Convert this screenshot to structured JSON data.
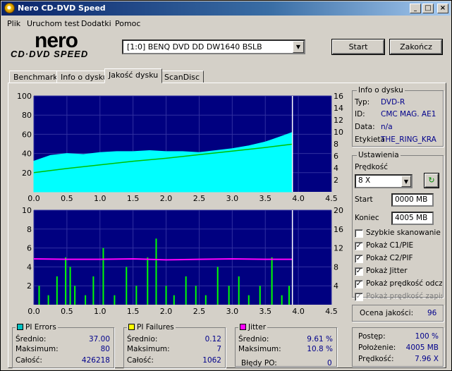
{
  "window": {
    "title": "Nero CD-DVD Speed"
  },
  "menu": [
    "Plik",
    "Uruchom test",
    "Dodatki",
    "Pomoc"
  ],
  "logo": {
    "nero": "nero",
    "sub": "CD·DVD SPEED"
  },
  "drive": {
    "selected": "[1:0]  BENQ DVD DD DW1640 BSLB"
  },
  "buttons": {
    "start": "Start",
    "stop": "Zakończ"
  },
  "tabs": [
    "Benchmark",
    "Info o dysku",
    "Jakość dysku",
    "ScanDisc"
  ],
  "disc_info": {
    "title": "Info o dysku",
    "type_label": "Typ:",
    "type": "DVD-R",
    "id_label": "ID:",
    "id": "CMC MAG. AE1",
    "date_label": "Data:",
    "date": "n/a",
    "label_label": "Etykieta",
    "label": "THE_RING_KRA"
  },
  "settings": {
    "title": "Ustawienia",
    "speed_label": "Prędkość",
    "speed": "8 X",
    "start_label": "Start",
    "start": "0000 MB",
    "end_label": "Koniec",
    "end": "4005 MB",
    "checks": [
      {
        "label": "Szybkie skanowanie",
        "checked": false,
        "enabled": true
      },
      {
        "label": "Pokaż C1/PIE",
        "checked": true,
        "enabled": true
      },
      {
        "label": "Pokaż C2/PIF",
        "checked": true,
        "enabled": true
      },
      {
        "label": "Pokaż Jitter",
        "checked": true,
        "enabled": true
      },
      {
        "label": "Pokaż prędkość odczytu",
        "checked": true,
        "enabled": true
      },
      {
        "label": "Pokaż prędkość zapisu",
        "checked": true,
        "enabled": false
      }
    ]
  },
  "quality": {
    "label": "Ocena jakości:",
    "value": "96"
  },
  "pi_errors": {
    "title": "PI Errors",
    "color": "#00c0c0",
    "avg_label": "Średnio:",
    "avg": "37.00",
    "max_label": "Maksimum:",
    "max": "80",
    "total_label": "Całość:",
    "total": "426218"
  },
  "pi_failures": {
    "title": "PI Failures",
    "color": "#ffff00",
    "avg_label": "Średnio:",
    "avg": "0.12",
    "max_label": "Maksimum:",
    "max": "7",
    "total_label": "Całość:",
    "total": "1062"
  },
  "jitter": {
    "title": "Jitter",
    "color": "#ff00ff",
    "avg_label": "Średnio:",
    "avg": "9.61 %",
    "max_label": "Maksimum:",
    "max": "10.8 %",
    "po_label": "Błędy PO:",
    "po": "0"
  },
  "progress": {
    "progress_label": "Postęp:",
    "progress": "100 %",
    "position_label": "Położenie:",
    "position": "4005 MB",
    "speed_label": "Prędkość:",
    "speed": "7.96 X"
  },
  "chart_data": [
    {
      "type": "area",
      "x_ticks": [
        "0.0",
        "0.5",
        "1.0",
        "1.5",
        "2.0",
        "2.5",
        "3.0",
        "3.5",
        "4.0",
        "4.5"
      ],
      "y_left_ticks": [
        "20",
        "40",
        "60",
        "80",
        "100"
      ],
      "y_right_ticks": [
        "2",
        "4",
        "6",
        "8",
        "10",
        "12",
        "14",
        "16"
      ],
      "xlim": [
        0,
        4.5
      ],
      "ylim": [
        0,
        100
      ],
      "y2lim": [
        0,
        16
      ],
      "end_marker": 3.91,
      "series": [
        {
          "color": "#00ffff",
          "x": [
            0,
            0.25,
            0.5,
            0.75,
            1.0,
            1.25,
            1.5,
            1.75,
            2.0,
            2.25,
            2.5,
            2.75,
            3.0,
            3.25,
            3.5,
            3.75,
            3.91
          ],
          "values": [
            32,
            38,
            40,
            39,
            41,
            42,
            42,
            43,
            42,
            42,
            41,
            43,
            45,
            48,
            52,
            58,
            62
          ]
        },
        {
          "color": "#00c000",
          "x": [
            0,
            0.5,
            1.0,
            1.5,
            2.0,
            2.5,
            3.0,
            3.5,
            3.91
          ],
          "values": [
            3.2,
            3.9,
            4.5,
            5.1,
            5.6,
            6.2,
            6.8,
            7.4,
            7.96
          ]
        }
      ]
    },
    {
      "type": "bar",
      "x_ticks": [
        "0.0",
        "0.5",
        "1.0",
        "1.5",
        "2.0",
        "2.5",
        "3.0",
        "3.5",
        "4.0",
        "4.5"
      ],
      "y_left_ticks": [
        "2",
        "4",
        "6",
        "8",
        "10"
      ],
      "y_right_ticks": [
        "4",
        "8",
        "12",
        "16",
        "20"
      ],
      "xlim": [
        0,
        4.5
      ],
      "ylim": [
        0,
        10
      ],
      "y2lim": [
        0,
        20
      ],
      "end_marker": 3.91,
      "series": [
        {
          "color": "#00ff00",
          "x": [
            0.08,
            0.22,
            0.35,
            0.48,
            0.55,
            0.62,
            0.78,
            0.9,
            1.05,
            1.22,
            1.4,
            1.55,
            1.72,
            1.85,
            2.0,
            2.12,
            2.3,
            2.45,
            2.6,
            2.78,
            2.95,
            3.1,
            3.25,
            3.42,
            3.6,
            3.75,
            3.86
          ],
          "values": [
            2,
            1,
            3,
            5,
            4,
            2,
            1,
            3,
            6,
            1,
            4,
            2,
            5,
            7,
            2,
            1,
            3,
            2,
            1,
            4,
            2,
            3,
            1,
            2,
            5,
            1,
            2
          ]
        },
        {
          "color": "#ff00ff",
          "x": [
            0,
            0.5,
            1.0,
            1.5,
            2.0,
            2.5,
            3.0,
            3.5,
            3.91
          ],
          "values": [
            9.7,
            9.6,
            9.6,
            9.7,
            9.5,
            9.6,
            9.7,
            9.6,
            9.6
          ]
        }
      ]
    }
  ]
}
